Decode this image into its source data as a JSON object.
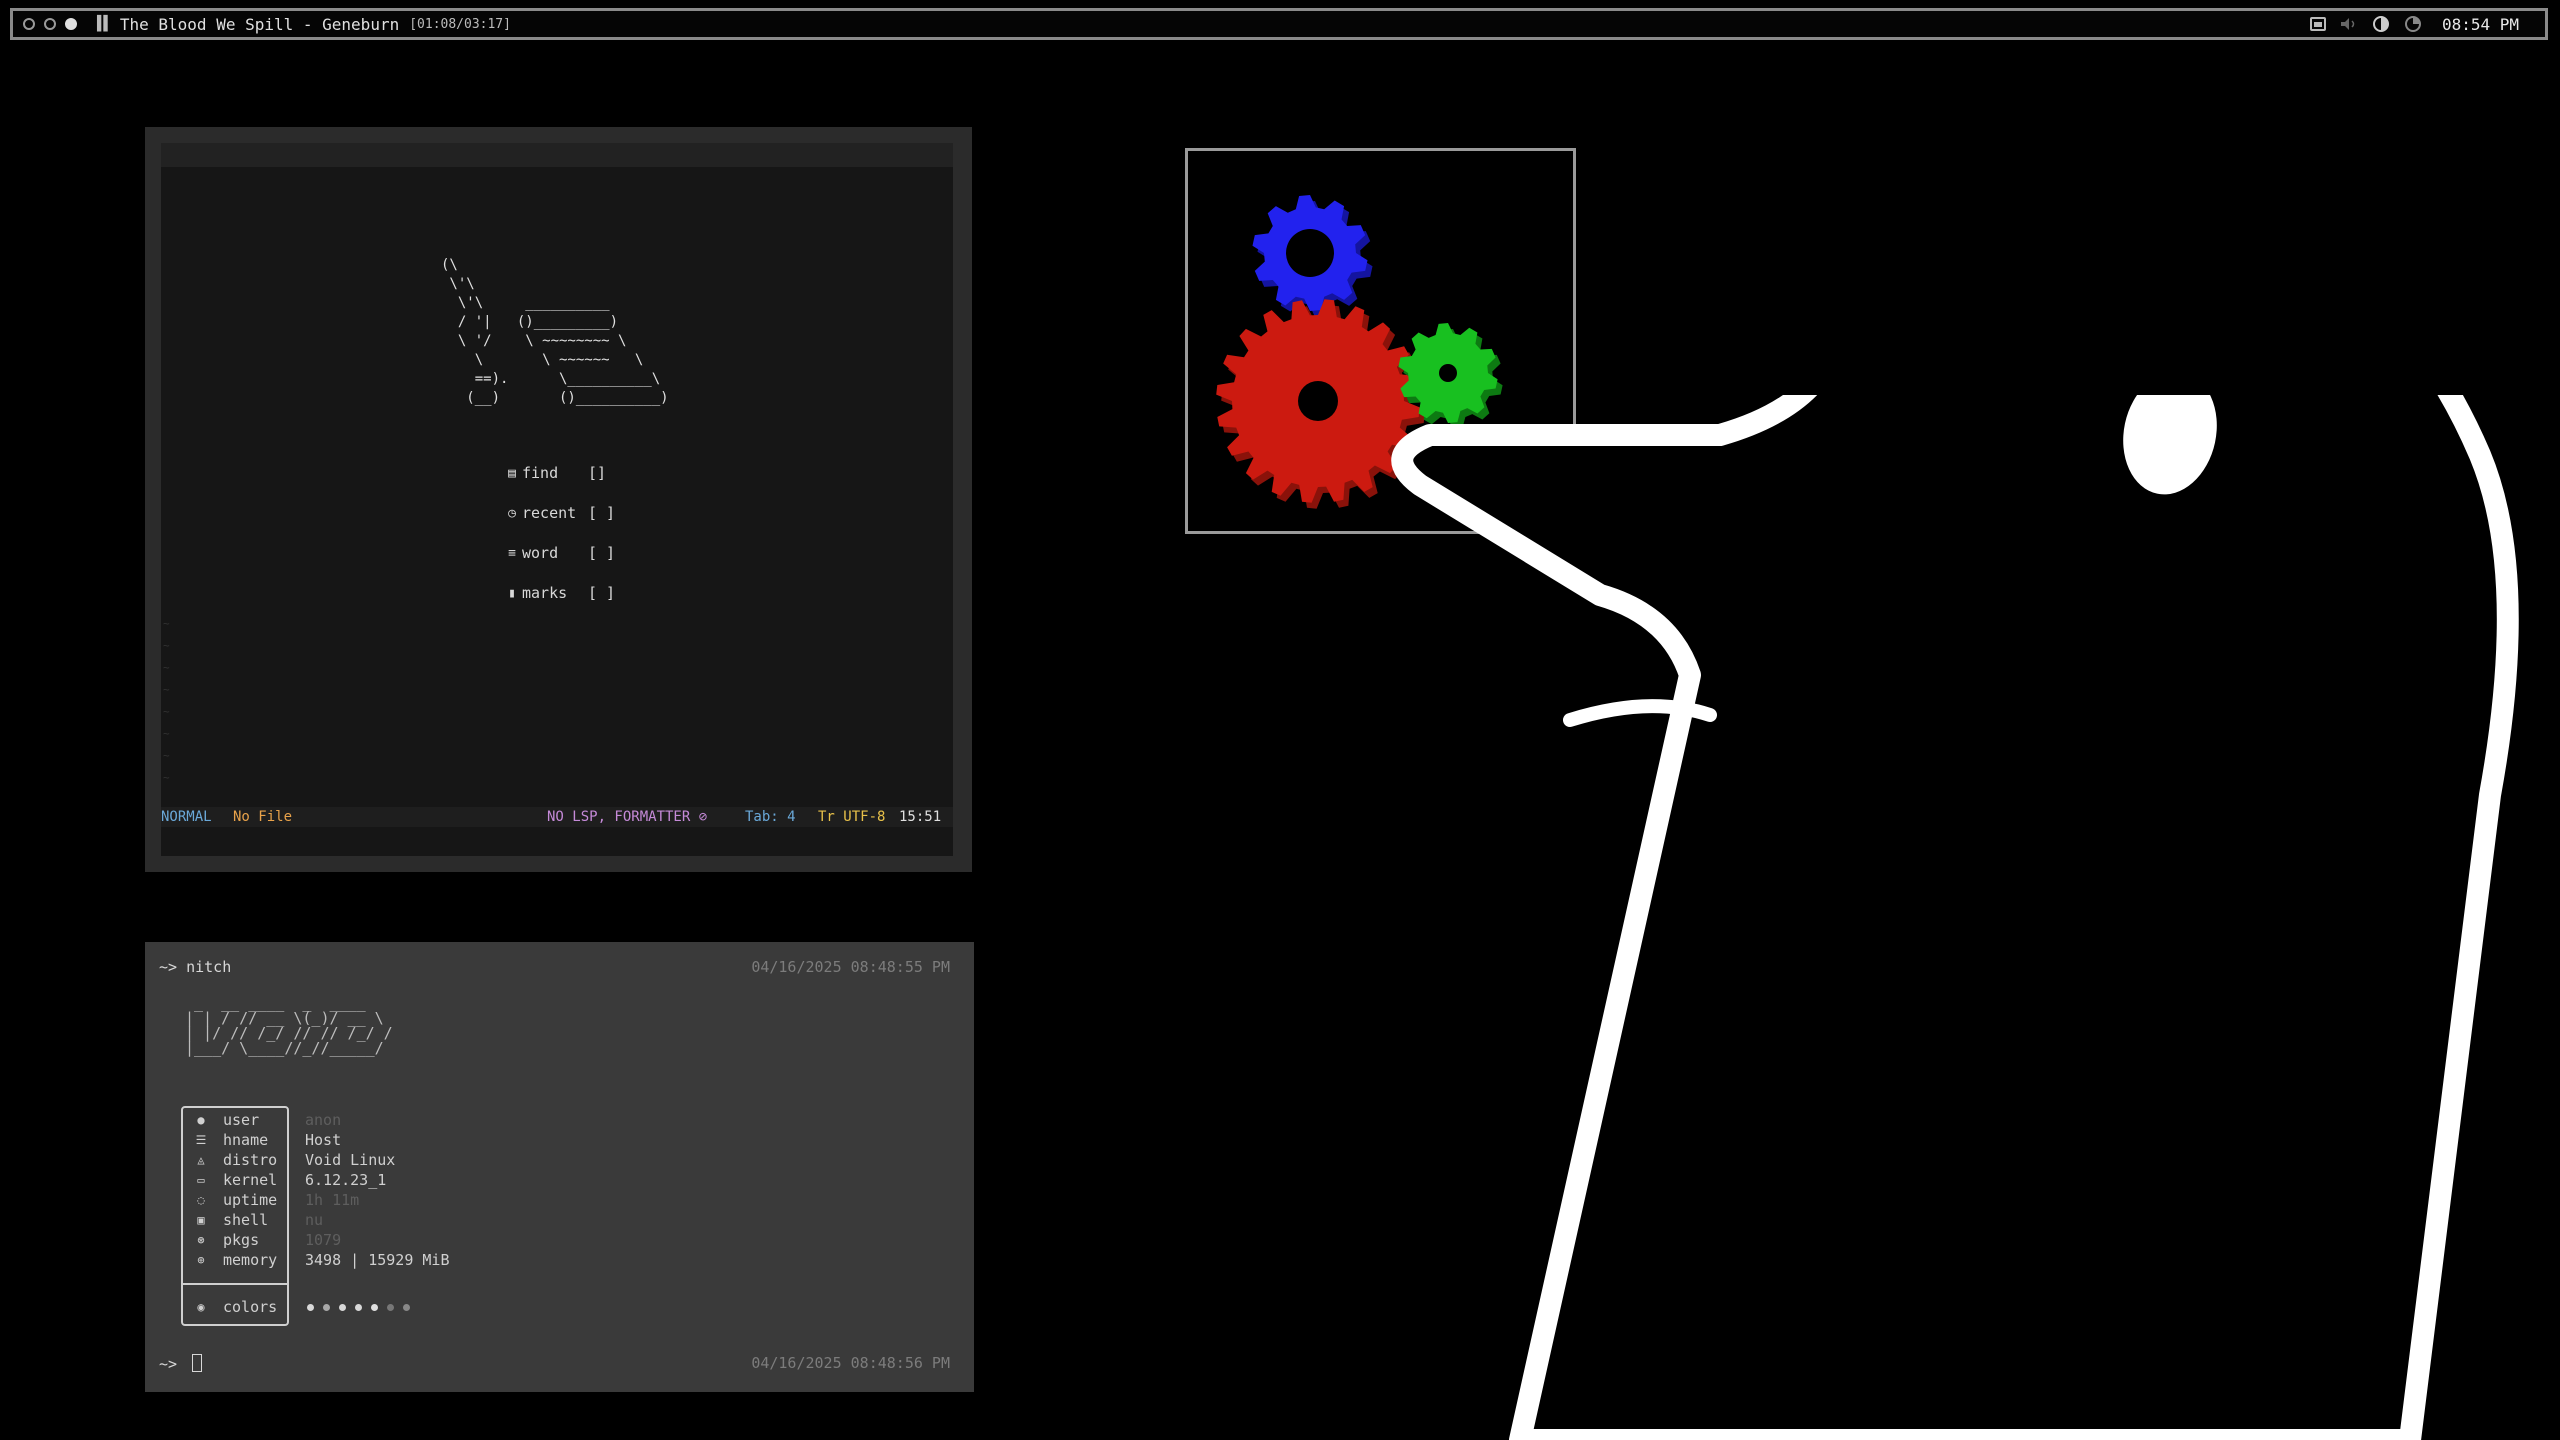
{
  "topbar": {
    "track": "The Blood We Spill - Geneburn",
    "progress": "[01:08/03:17]",
    "clock": "08:54 PM",
    "icons": [
      "screen-icon",
      "volume-icon",
      "brightness-icon",
      "battery-icon"
    ]
  },
  "editor": {
    "ascii_art": "(\\\n \\'\\\n  \\'\\     __________\n  / '|   ()_________)\n  \\ '/    \\ ~~~~~~~~ \\\n    \\       \\ ~~~~~~   \\\n    ==).      \\__________\\\n   (__)       ()__________)",
    "menu": [
      {
        "icon": "file-search-icon",
        "glyph": "▤",
        "label": "find",
        "key": "[]"
      },
      {
        "icon": "clock-icon",
        "glyph": "◷",
        "label": "recent",
        "key": "[ ]"
      },
      {
        "icon": "lines-icon",
        "glyph": "≡",
        "label": "word",
        "key": "[ ]"
      },
      {
        "icon": "bookmark-icon",
        "glyph": "▮",
        "label": "marks",
        "key": "[ ]"
      }
    ],
    "status": {
      "mode": "NORMAL",
      "file": "No File",
      "lsp": "NO LSP, FORMATTER ⊘",
      "tab": "Tab: 4",
      "encoding": "Tr UTF-8",
      "time": "15:51"
    }
  },
  "terminal": {
    "prompt1": "~> nitch",
    "timestamp1": "04/16/2025 08:48:55 PM",
    "void_ascii": " _  __ ____  _  ____\n| | / // __ \\(_)/ __ \\\n| |/ // /_/ // // /_/ /\n|___/ \\____//_//_____/",
    "info": [
      {
        "icon": "user-icon",
        "glyph": "●",
        "label": "user",
        "value": "anon",
        "dim": true
      },
      {
        "icon": "host-icon",
        "glyph": "☰",
        "label": "hname",
        "value": "Host",
        "dim": false
      },
      {
        "icon": "lock-icon",
        "glyph": "◬",
        "label": "distro",
        "value": "Void Linux",
        "dim": false
      },
      {
        "icon": "laptop-icon",
        "glyph": "▭",
        "label": "kernel",
        "value": "6.12.23_1",
        "dim": false
      },
      {
        "icon": "clock-icon",
        "glyph": "◌",
        "label": "uptime",
        "value": "1h 11m",
        "dim": true
      },
      {
        "icon": "terminal-icon",
        "glyph": "▣",
        "label": "shell",
        "value": "nu",
        "dim": true
      },
      {
        "icon": "package-icon",
        "glyph": "⊛",
        "label": "pkgs",
        "value": "1079",
        "dim": true
      },
      {
        "icon": "memory-icon",
        "glyph": "⊕",
        "label": "memory",
        "value": "3498 | 15929 MiB",
        "dim": false
      }
    ],
    "colors_label": "colors",
    "color_dots": [
      "#d8d8d8",
      "#a8a8a8",
      "#d8d8d8",
      "#d8d8d8",
      "#e0e0e0",
      "#777777",
      "#888888"
    ],
    "prompt2": "~>",
    "timestamp2": "04/16/2025 08:48:56 PM"
  },
  "colors": {
    "gear_blue": "#2222ee",
    "gear_red": "#cc1a10",
    "gear_green": "#18c020",
    "accent_blue": "#6aa8d8",
    "accent_orange": "#e8a24a",
    "accent_purple": "#c58ad8",
    "accent_yellow": "#e8c14a"
  }
}
